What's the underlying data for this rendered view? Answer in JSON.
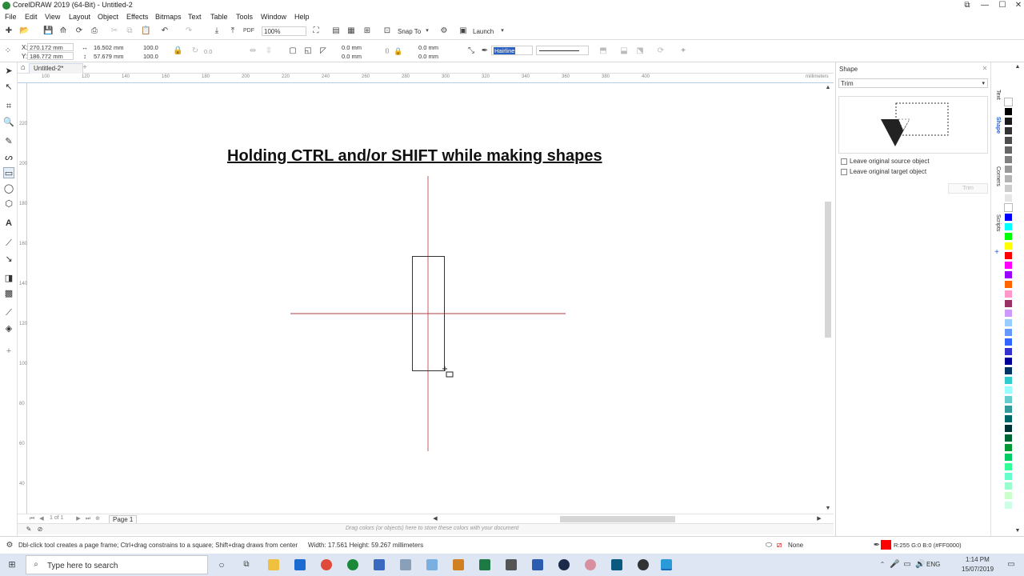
{
  "window": {
    "title": "CorelDRAW 2019 (64-Bit) - Untitled-2",
    "controls": {
      "restore": "⧉",
      "minimize": "—",
      "maximize": "☐",
      "close": "✕"
    }
  },
  "menu": [
    "File",
    "Edit",
    "View",
    "Layout",
    "Object",
    "Effects",
    "Bitmaps",
    "Text",
    "Table",
    "Tools",
    "Window",
    "Help"
  ],
  "toolbar": {
    "zoom_value": "100%",
    "snap_label": "Snap To",
    "launch_label": "Launch"
  },
  "propbar": {
    "x_label": "X:",
    "x_value": "270.172 mm",
    "y_label": "Y:",
    "y_value": "186.772 mm",
    "width_value": "16.502 mm",
    "height_value": "57.679 mm",
    "scale_w": "100.0",
    "scale_h": "100.0",
    "rotation": "0.0",
    "corner_1": "0.0 mm",
    "corner_2": "0.0 mm",
    "corner_3": "0.0 mm",
    "corner_4": "0.0 mm",
    "outline_width": "Hairline"
  },
  "document": {
    "tab": "Untitled-2*",
    "ruler_unit": "millimeters",
    "hruler_labels": [
      "100",
      "120",
      "140",
      "160",
      "180",
      "200",
      "220",
      "240",
      "260",
      "280",
      "300",
      "320",
      "340",
      "360",
      "380",
      "400"
    ],
    "vruler_labels": [
      "220",
      "200",
      "180",
      "160",
      "140",
      "120",
      "100",
      "80",
      "60",
      "40",
      "20"
    ],
    "heading": "Holding CTRL and/or SHIFT while making shapes",
    "page_nav": "1 of 1",
    "page_tab": "Page 1",
    "palette_hint": "Drag colors (or objects) here to store these colors with your document"
  },
  "docker": {
    "title": "Shape",
    "mode": "Trim",
    "option_source": "Leave original source object",
    "option_target": "Leave original target object",
    "action_button": "Trim",
    "tabs": [
      "Text",
      "Shape",
      "Corners",
      "Scripts"
    ]
  },
  "statusbar": {
    "hint": "Dbl-click tool creates a page frame; Ctrl+drag constrains to a square; Shift+drag draws from center",
    "dimensions": "Width: 17.561  Height: 59.267  millimeters",
    "fill_label": "None",
    "outline_label": "R:255 G:0 B:0 (#FF0000)"
  },
  "taskbar": {
    "search_placeholder": "Type here to search",
    "language": "ENG",
    "time": "1:14 PM",
    "date": "15/07/2019"
  },
  "colors": {
    "guide": "#b03030",
    "outline_swatch": "#ff0000",
    "palette": [
      "#ffffff",
      "#000000",
      "#1a1a1a",
      "#333333",
      "#4d4d4d",
      "#666666",
      "#808080",
      "#999999",
      "#b3b3b3",
      "#cccccc",
      "#e6e6e6",
      "#ffffff",
      "#0000ff",
      "#00ffff",
      "#00ff00",
      "#ffff00",
      "#ff0000",
      "#ff00ff",
      "#9900ff",
      "#ff6600",
      "#ff99cc",
      "#993366",
      "#cc99ff",
      "#99ccff",
      "#6699ff",
      "#3366ff",
      "#3333cc",
      "#000099",
      "#003366",
      "#33cccc",
      "#99ffff",
      "#66cccc",
      "#339999",
      "#006666",
      "#003333",
      "#006633",
      "#009933",
      "#00cc66",
      "#33ff99",
      "#66ffcc",
      "#99ffcc",
      "#ccffcc",
      "#ccffe6"
    ]
  }
}
